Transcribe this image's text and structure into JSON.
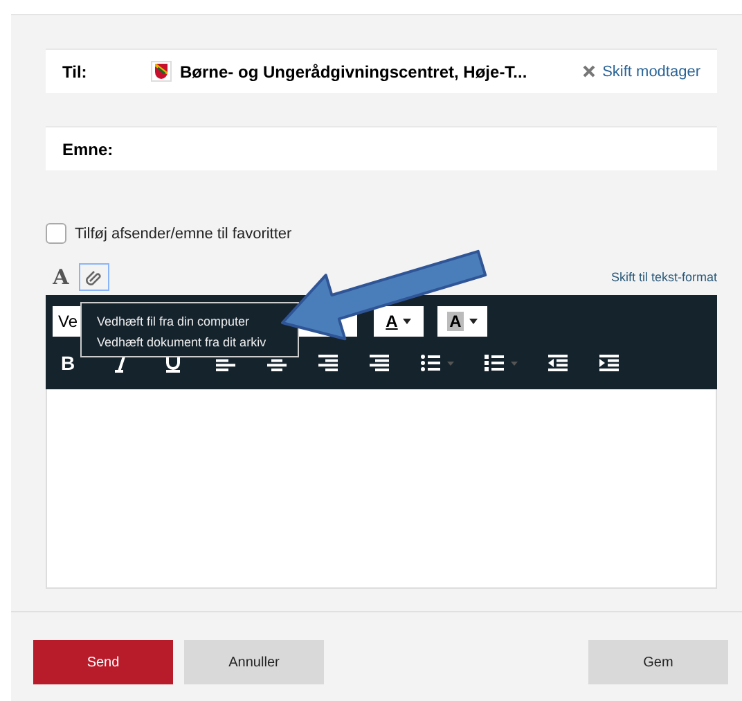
{
  "recipient": {
    "label": "Til:",
    "name": "Børne- og Ungerådgivningscentret, Høje-T...",
    "change_link": "Skift modtager"
  },
  "subject": {
    "label": "Emne:"
  },
  "favorite": {
    "label": "Tilføj afsender/emne til favoritter",
    "checked": false
  },
  "editor": {
    "tabs": [
      {
        "kind": "format",
        "label": "A",
        "selected": false
      },
      {
        "kind": "attach",
        "selected": true
      }
    ],
    "switch_link": "Skift til tekst-format",
    "font_dropdown": "Ve",
    "text_color": "A",
    "highlight_color": "A",
    "bold": "B",
    "attach_menu": [
      "Vedhæft fil fra din computer",
      "Vedhæft dokument fra dit arkiv"
    ]
  },
  "buttons": [
    {
      "label": "Send",
      "kind": "primary"
    },
    {
      "label": "Annuller",
      "kind": "secondary"
    },
    {
      "label": "Gem",
      "kind": "secondary"
    }
  ]
}
